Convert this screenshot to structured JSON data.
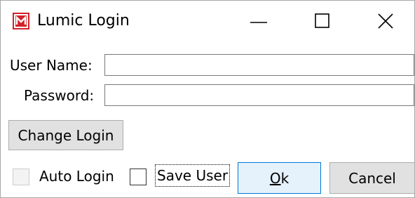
{
  "window": {
    "title": "Lumic Login",
    "icon": "lumic-app-icon",
    "controls": {
      "minimize": "minimize-icon",
      "maximize": "maximize-icon",
      "close": "close-icon"
    }
  },
  "form": {
    "username_label": "User Name:",
    "username_value": "",
    "password_label": "Password:",
    "password_value": ""
  },
  "buttons": {
    "change_login": "Change Login",
    "ok_mnemonic": "O",
    "ok_rest": "k",
    "cancel": "Cancel"
  },
  "options": {
    "auto_login_label": "Auto Login",
    "auto_login_checked": false,
    "auto_login_enabled": false,
    "save_user_label": "Save User",
    "save_user_checked": false
  },
  "colors": {
    "accent": "#0078d7",
    "brand": "#d1222a"
  }
}
